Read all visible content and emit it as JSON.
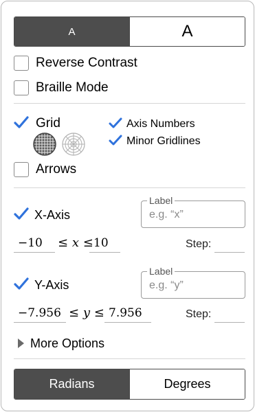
{
  "font_size_toggle": {
    "small_label": "A",
    "large_label": "A",
    "selected": "small"
  },
  "accessibility": {
    "reverse_contrast": {
      "label": "Reverse Contrast",
      "checked": false
    },
    "braille_mode": {
      "label": "Braille Mode",
      "checked": false
    }
  },
  "grid": {
    "grid": {
      "label": "Grid",
      "checked": true
    },
    "grid_type_icons": [
      "cartesian-grid-icon",
      "polar-grid-icon"
    ],
    "axis_numbers": {
      "label": "Axis Numbers",
      "checked": true
    },
    "minor_gridlines": {
      "label": "Minor Gridlines",
      "checked": true
    },
    "arrows": {
      "label": "Arrows",
      "checked": false
    }
  },
  "x_axis": {
    "label": "X-Axis",
    "checked": true,
    "label_field": {
      "legend": "Label",
      "placeholder": "e.g. “x”"
    },
    "min": "−10",
    "variable": "x",
    "max": "10",
    "step_label": "Step:",
    "step_value": ""
  },
  "y_axis": {
    "label": "Y-Axis",
    "checked": true,
    "label_field": {
      "legend": "Label",
      "placeholder": "e.g. “y”"
    },
    "min": "−7.956",
    "variable": "y",
    "max": "7.956",
    "step_label": "Step:",
    "step_value": ""
  },
  "more_options": {
    "label": "More Options"
  },
  "angle_mode": {
    "radians_label": "Radians",
    "degrees_label": "Degrees",
    "selected": "radians"
  },
  "colors": {
    "accent_check": "#2f72dc",
    "active_toggle": "#4d4d4d"
  }
}
